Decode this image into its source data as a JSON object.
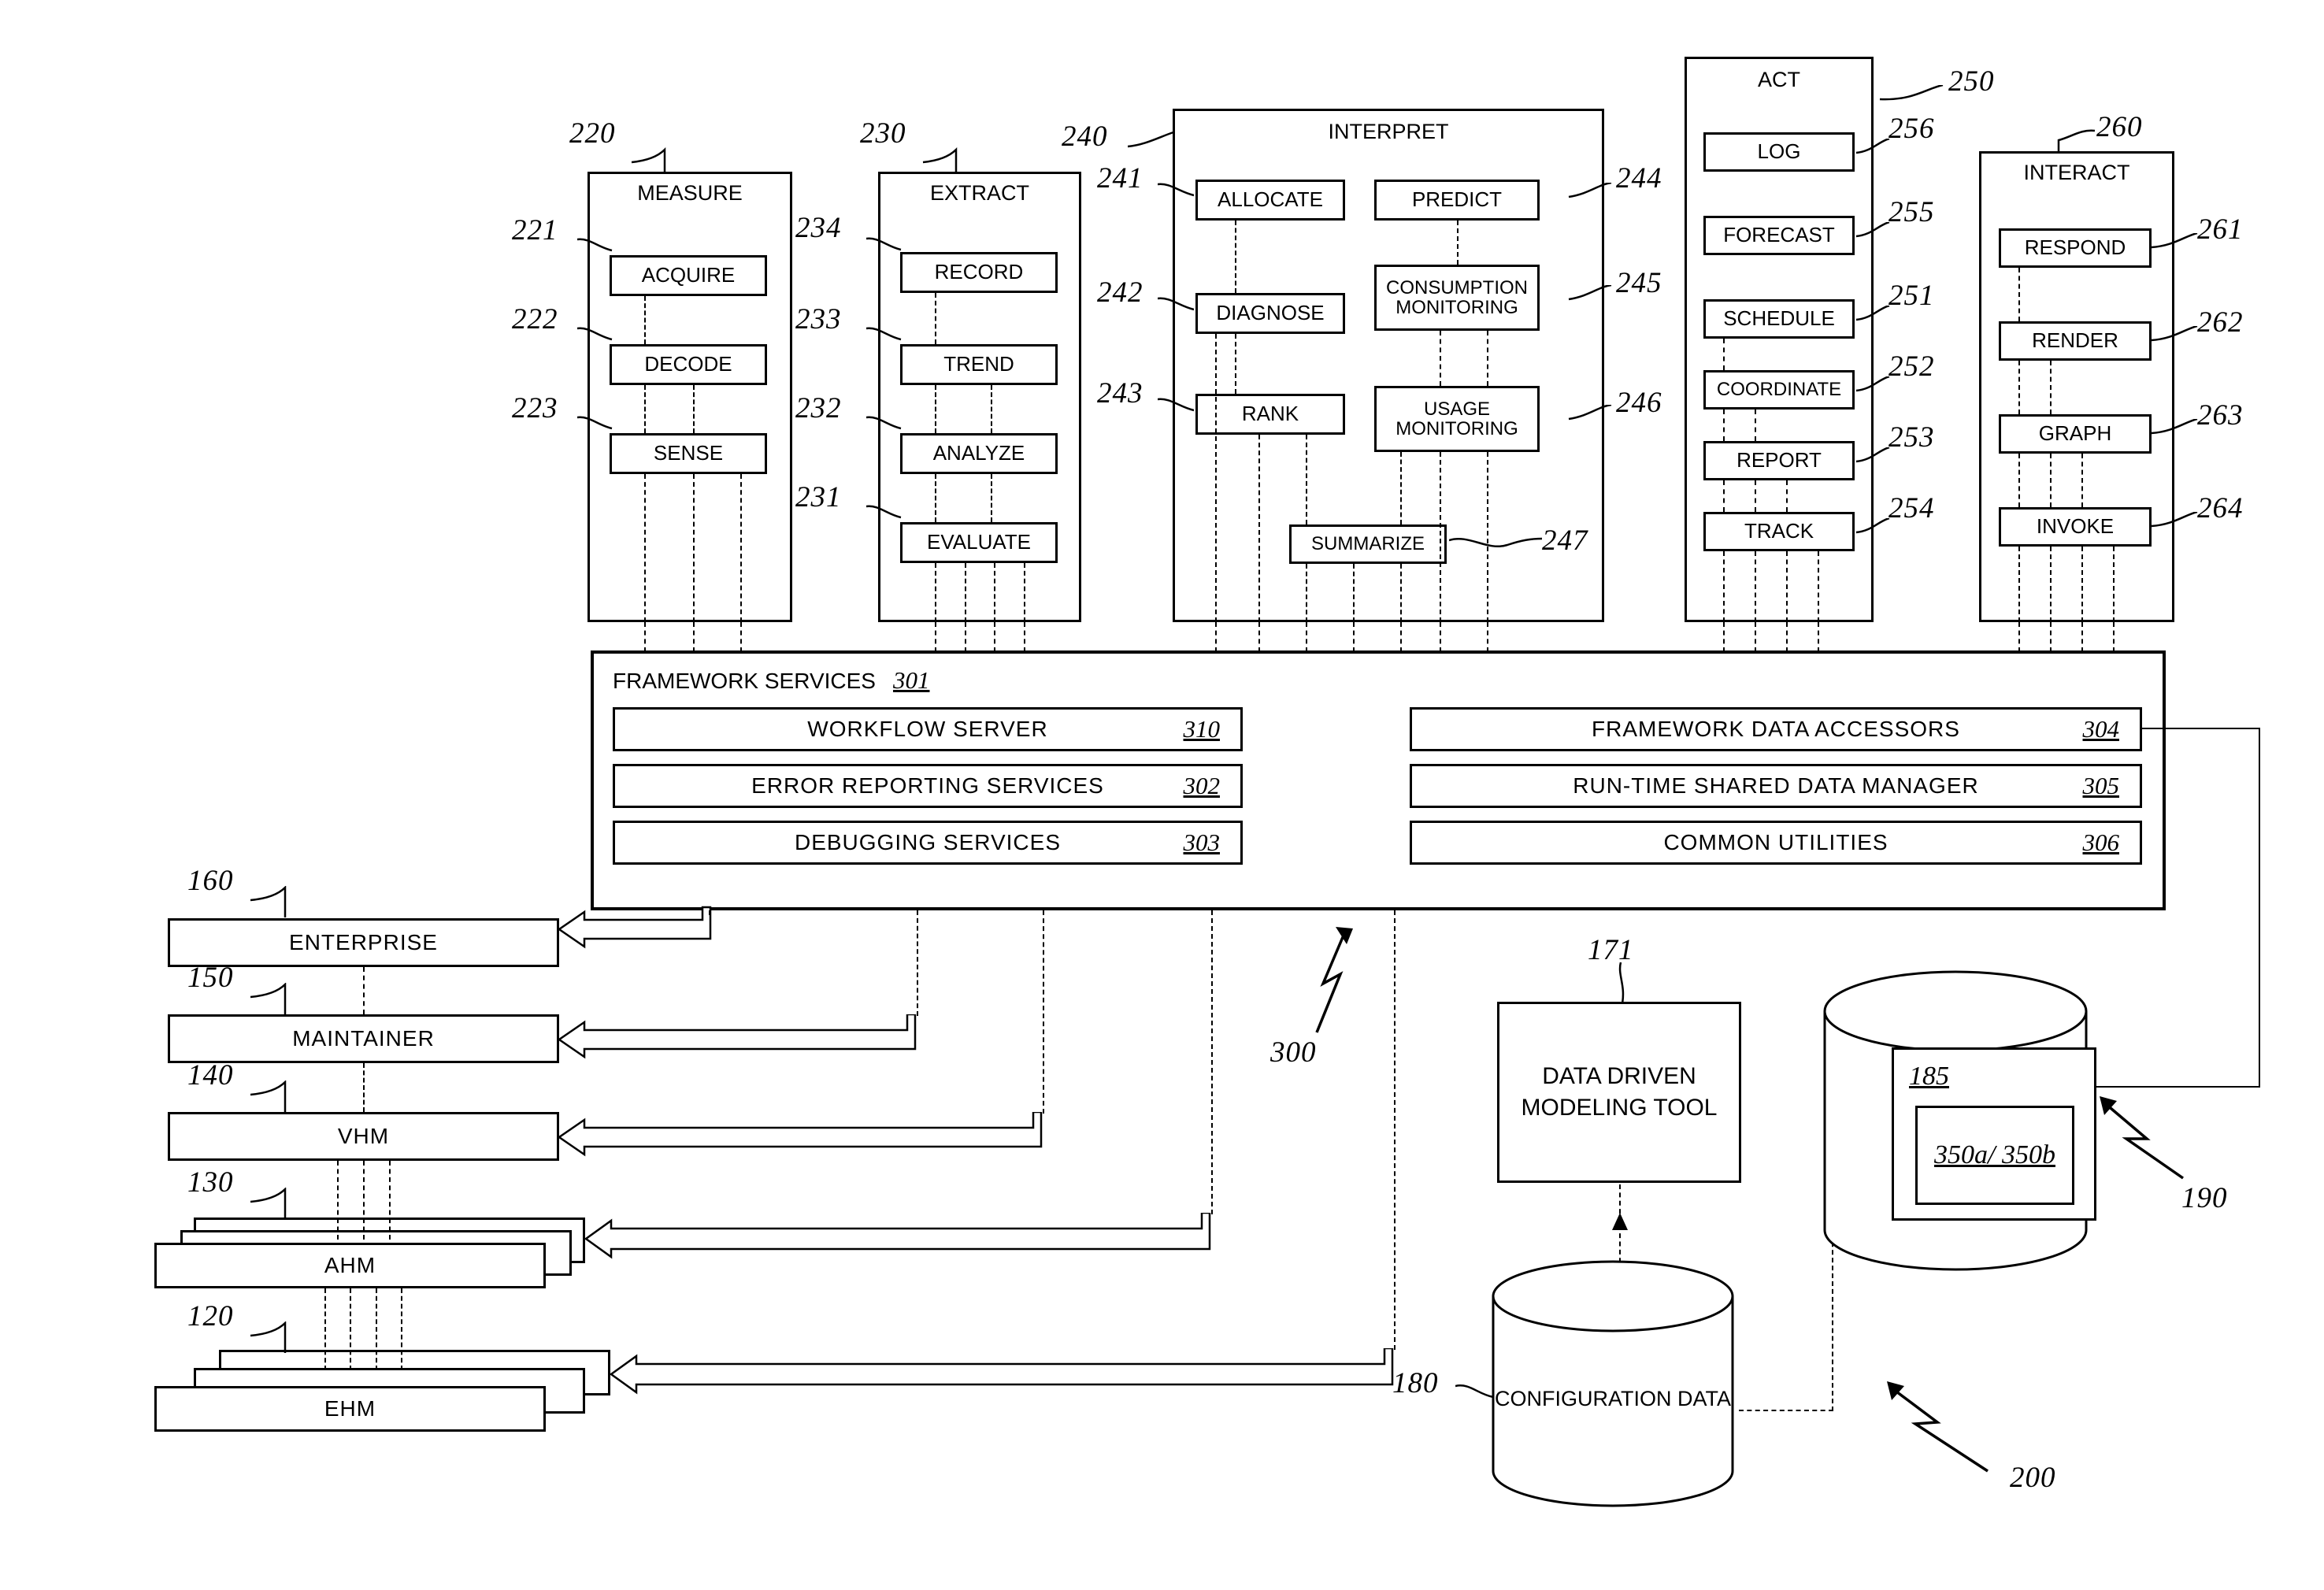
{
  "figure": {
    "system_ref": "300",
    "framework_ref": "200",
    "database_ref": "190"
  },
  "modules": [
    {
      "ref": "220",
      "title": "MEASURE",
      "items": [
        {
          "ref": "221",
          "label": "ACQUIRE"
        },
        {
          "ref": "222",
          "label": "DECODE"
        },
        {
          "ref": "223",
          "label": "SENSE"
        }
      ]
    },
    {
      "ref": "230",
      "title": "EXTRACT",
      "items": [
        {
          "ref": "234",
          "label": "RECORD"
        },
        {
          "ref": "233",
          "label": "TREND"
        },
        {
          "ref": "232",
          "label": "ANALYZE"
        },
        {
          "ref": "231",
          "label": "EVALUATE"
        }
      ]
    },
    {
      "ref": "240",
      "title": "INTERPRET",
      "items": [
        {
          "ref": "241",
          "label": "ALLOCATE"
        },
        {
          "ref": "242",
          "label": "DIAGNOSE"
        },
        {
          "ref": "243",
          "label": "RANK"
        },
        {
          "ref": "244",
          "label": "PREDICT"
        },
        {
          "ref": "245",
          "label": "CONSUMPTION MONITORING"
        },
        {
          "ref": "246",
          "label": "USAGE MONITORING"
        },
        {
          "ref": "247",
          "label": "SUMMARIZE"
        }
      ]
    },
    {
      "ref": "250",
      "title": "ACT",
      "items": [
        {
          "ref": "256",
          "label": "LOG"
        },
        {
          "ref": "255",
          "label": "FORECAST"
        },
        {
          "ref": "251",
          "label": "SCHEDULE"
        },
        {
          "ref": "252",
          "label": "COORDINATE"
        },
        {
          "ref": "253",
          "label": "REPORT"
        },
        {
          "ref": "254",
          "label": "TRACK"
        }
      ]
    },
    {
      "ref": "260",
      "title": "INTERACT",
      "items": [
        {
          "ref": "261",
          "label": "RESPOND"
        },
        {
          "ref": "262",
          "label": "RENDER"
        },
        {
          "ref": "263",
          "label": "GRAPH"
        },
        {
          "ref": "264",
          "label": "INVOKE"
        }
      ]
    }
  ],
  "framework_services": {
    "title": "FRAMEWORK SERVICES",
    "ref": "301",
    "left_rows": [
      {
        "label": "WORKFLOW SERVER",
        "num": "310"
      },
      {
        "label": "ERROR REPORTING SERVICES",
        "num": "302"
      },
      {
        "label": "DEBUGGING SERVICES",
        "num": "303"
      }
    ],
    "right_rows": [
      {
        "label": "FRAMEWORK DATA ACCESSORS",
        "num": "304"
      },
      {
        "label": "RUN-TIME SHARED DATA MANAGER",
        "num": "305"
      },
      {
        "label": "COMMON UTILITIES",
        "num": "306"
      }
    ]
  },
  "hierarchy": [
    {
      "ref": "160",
      "label": "ENTERPRISE",
      "stacked": false
    },
    {
      "ref": "150",
      "label": "MAINTAINER",
      "stacked": false
    },
    {
      "ref": "140",
      "label": "VHM",
      "stacked": false
    },
    {
      "ref": "130",
      "label": "AHM",
      "stacked": true
    },
    {
      "ref": "120",
      "label": "EHM",
      "stacked": true
    }
  ],
  "tools": {
    "modeling_tool": {
      "ref": "171",
      "label": "DATA DRIVEN MODELING TOOL"
    },
    "configuration_data": {
      "ref": "180",
      "label": "CONFIGURATION DATA"
    },
    "database": {
      "ref": "190",
      "inner_num": "185",
      "inner_label": "350a/ 350b"
    }
  }
}
